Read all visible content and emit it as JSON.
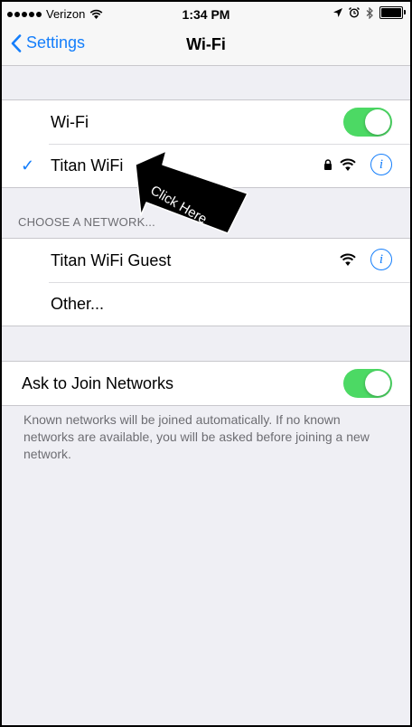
{
  "status_bar": {
    "carrier": "Verizon",
    "time": "1:34 PM",
    "battery_level": 1.0
  },
  "nav": {
    "back_label": "Settings",
    "title": "Wi-Fi"
  },
  "wifi_group": {
    "wifi_label": "Wi-Fi",
    "wifi_on": true,
    "connected_network": "Titan WiFi",
    "connected_secured": true
  },
  "annotation": {
    "text": "Click Here"
  },
  "networks": {
    "header": "CHOOSE A NETWORK...",
    "items": [
      {
        "name": "Titan WiFi Guest"
      },
      {
        "name": "Other..."
      }
    ]
  },
  "ask_to_join": {
    "label": "Ask to Join Networks",
    "on": true,
    "note": "Known networks will be joined automatically. If no known networks are available, you will be asked before joining a new network."
  },
  "colors": {
    "accent": "#147efb",
    "toggle_on": "#4cd964",
    "background": "#efeff4"
  }
}
